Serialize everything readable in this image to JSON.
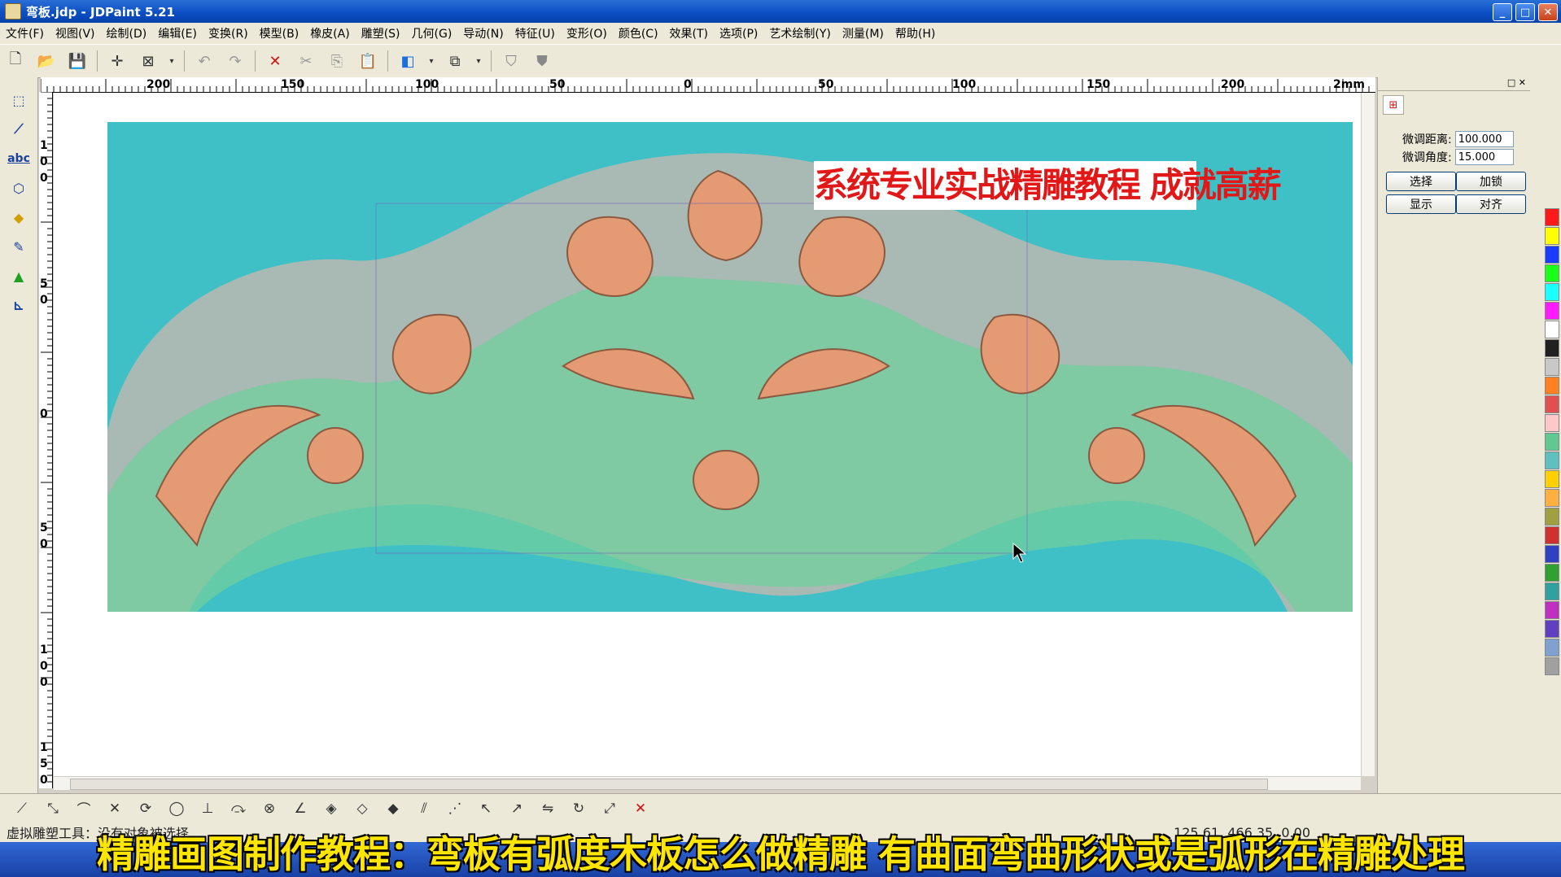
{
  "window": {
    "title": "弯板.jdp - JDPaint 5.21"
  },
  "menu": [
    "文件(F)",
    "视图(V)",
    "绘制(D)",
    "编辑(E)",
    "变换(R)",
    "模型(B)",
    "橡皮(A)",
    "雕塑(S)",
    "几何(G)",
    "导动(N)",
    "特征(U)",
    "变形(O)",
    "颜色(C)",
    "效果(T)",
    "选项(P)",
    "艺术绘制(Y)",
    "测量(M)",
    "帮助(H)"
  ],
  "ruler": {
    "unit": "mm",
    "top_labels": [
      "200",
      "150",
      "100",
      "50",
      "0",
      "50",
      "100",
      "150",
      "200",
      "2mm"
    ],
    "left_labels": [
      "1",
      "0",
      "0",
      "5",
      "0",
      "0",
      "5",
      "0",
      "1",
      "0",
      "0",
      "1",
      "5",
      "0"
    ]
  },
  "canvas": {
    "banner_text": "系统专业实战精雕教程 成就高薪",
    "relief_colors": {
      "background": "#3ec0c6",
      "board": "#a9b9b3",
      "carving_orange": "#e49a72",
      "carving_green": "#6fcf9a"
    }
  },
  "panel": {
    "fine_distance_label": "微调距离:",
    "fine_distance_value": "100.000",
    "fine_angle_label": "微调角度:",
    "fine_angle_value": "15.000",
    "buttons": {
      "select": "选择",
      "lock": "加锁",
      "show": "显示",
      "align": "对齐"
    }
  },
  "palette": [
    "#ff1a1a",
    "#ffff00",
    "#1a3cff",
    "#1aff1a",
    "#1affff",
    "#ff1aff",
    "#ffffff",
    "#202020",
    "#c8c8c8",
    "#ff8020",
    "#e05050",
    "#ffc8c8",
    "#60c890",
    "#60c0c0",
    "#ffd000",
    "#ffb040",
    "#a0a040",
    "#d03030",
    "#3040c0",
    "#30a030",
    "#30a0a0",
    "#c030c0",
    "#6040c0",
    "#80a0d0",
    "#a0a0a0"
  ],
  "status": {
    "left_text": "虚拟雕塑工具：没有对象被选择",
    "coords": "125.61, 466.35, 0.00"
  },
  "caption": "精雕画图制作教程：弯板有弧度木板怎么做精雕   有曲面弯曲形状或是弧形在精雕处理"
}
